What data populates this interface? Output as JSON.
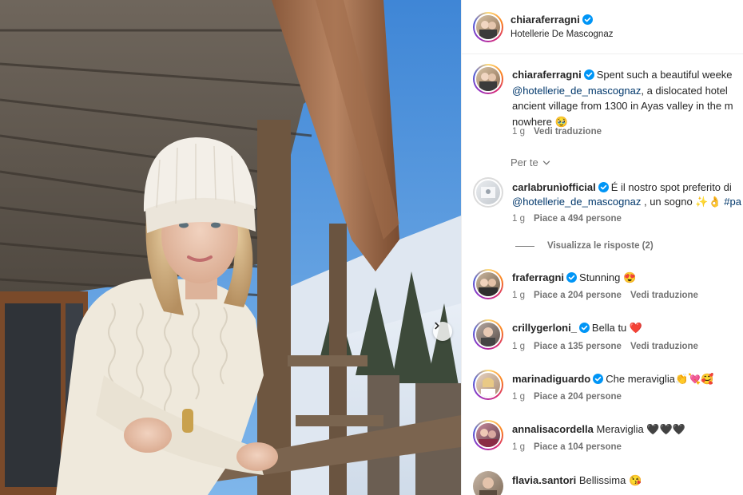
{
  "post": {
    "username": "chiaraferragni",
    "location": "Hotellerie De Mascognaz"
  },
  "caption": {
    "username": "chiaraferragni",
    "text_line1": "Spent such a beautiful weeke",
    "mention": "@hotellerie_de_mascognaz",
    "text_line2": ", a dislocated hotel",
    "text_line3": "ancient village from 1300 in Ayas valley in the m",
    "text_line4": "nowhere 🥹",
    "time": "1 g",
    "translate": "Vedi traduzione"
  },
  "section_label": "Per te",
  "comments": [
    {
      "username": "carlabrunìofficial",
      "text": "É il nostro spot preferito di",
      "line2_mention": "@hotellerie_de_mascognaz",
      "line2_text": " , un sogno ✨👌",
      "line2_hashtag": "#pa",
      "time": "1 g",
      "likes": "Piace a 494 persone",
      "replies": "Visualizza le risposte (2)"
    },
    {
      "username": "fraferragni",
      "text": "Stunning 😍",
      "time": "1 g",
      "likes": "Piace a 204 persone",
      "translate": "Vedi traduzione"
    },
    {
      "username": "crillygerloni_",
      "text": "Bella tu ❤️",
      "time": "1 g",
      "likes": "Piace a 135 persone",
      "translate": "Vedi traduzione"
    },
    {
      "username": "marinadiguardo",
      "text": "Che meraviglia👏💘🥰",
      "time": "1 g",
      "likes": "Piace a 204 persone"
    },
    {
      "username": "annalisacordella",
      "text": "Meraviglia 🖤🖤🖤",
      "time": "1 g",
      "likes": "Piace a 104 persone"
    },
    {
      "username": "flavia.santori",
      "text": "Bellissima 😘"
    }
  ],
  "icons": {
    "verified": "verified-badge-icon",
    "next": "chevron-right-icon",
    "expand": "chevron-down-icon"
  },
  "colors": {
    "link": "#00376b",
    "verified": "#0095f6",
    "muted": "#737373"
  }
}
